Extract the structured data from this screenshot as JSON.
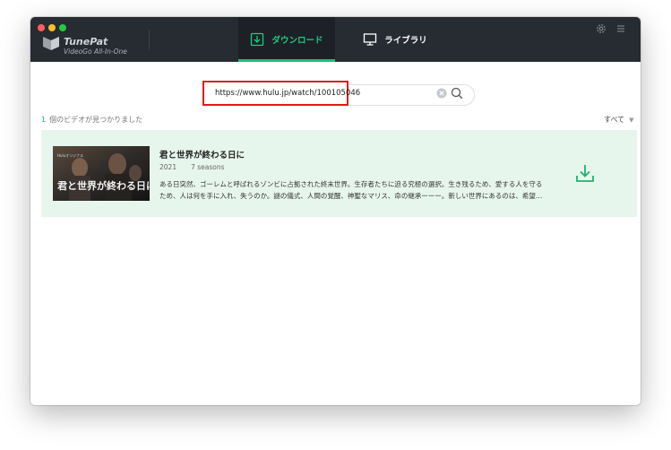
{
  "app": {
    "name": "TunePat",
    "subtitle": "VideoGo All-In-One"
  },
  "tabs": [
    {
      "label": "ダウンロード",
      "active": true
    },
    {
      "label": "ライブラリ",
      "active": false
    }
  ],
  "search": {
    "value": "https://www.hulu.jp/watch/100105046"
  },
  "results_bar": {
    "count": "1",
    "count_text": "個のビデオが見つかりました",
    "filter_label": "すべて"
  },
  "results": [
    {
      "title": "君と世界が終わる日に",
      "year": "2021",
      "seasons": "7 seasons",
      "description_line1": "ある日突然、ゴーレムと呼ばれるゾンビに占拠された終末世界。生存者たちに迫る究極の選択。生き残るため、愛する人を守る",
      "description_line2": "ため、人は何を手に入れ、失うのか。謎の儀式、人間の覚醒、神聖なマリス、命の継承ーーー。新しい世界にあるのは、希望…",
      "poster_text": "君と世界が終わる日に",
      "poster_badge": "Huluオリジナル"
    }
  ],
  "colors": {
    "accent": "#1bb36f",
    "titlebar": "#272c33",
    "result_bg": "#e7f6ed",
    "highlight": "#e11a1a"
  },
  "icons": {
    "settings": "gear-icon",
    "menu": "menu-icon",
    "download_tab": "download-icon",
    "library_tab": "monitor-icon",
    "clear": "clear-icon",
    "search": "search-icon",
    "download_item": "download-icon"
  }
}
